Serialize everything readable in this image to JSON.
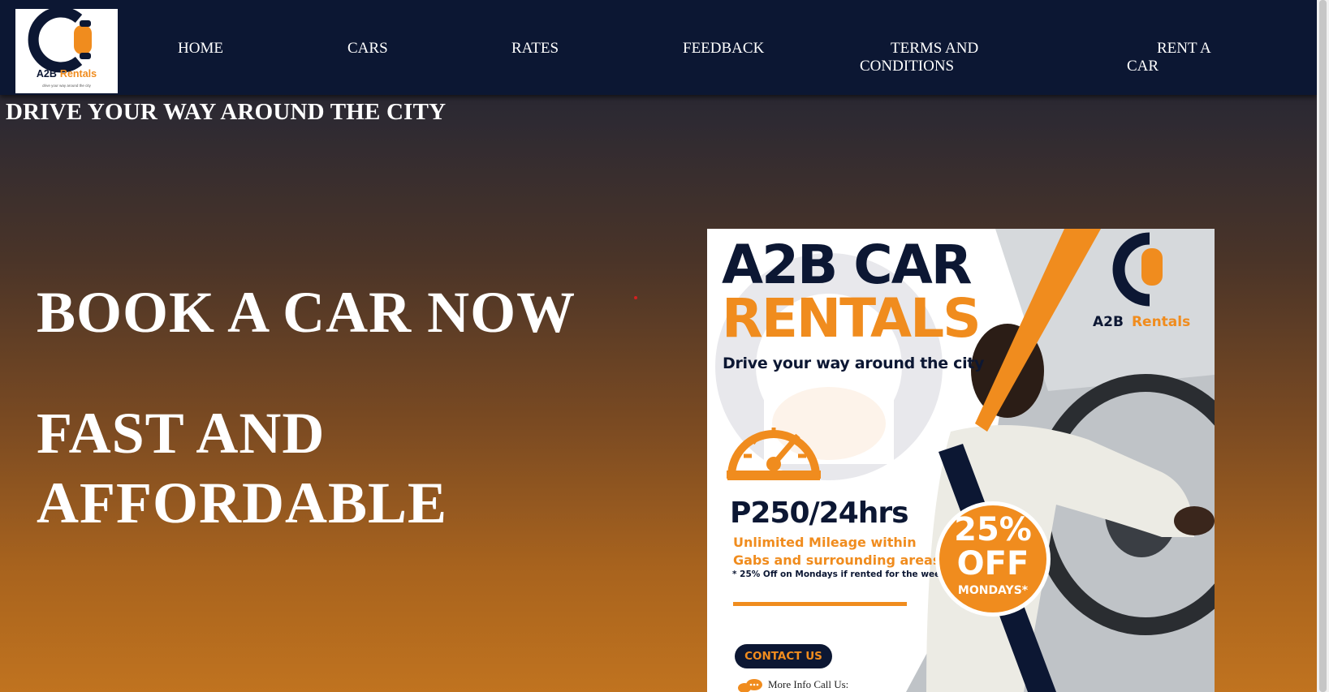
{
  "nav": {
    "logo": {
      "name_a2b": "A2B",
      "name_rentals": "Rentals",
      "tagline": "drive your way around the city"
    },
    "items": [
      {
        "label": "HOME"
      },
      {
        "label": "CARS"
      },
      {
        "label": "RATES"
      },
      {
        "label": "FEEDBACK"
      },
      {
        "label_line1": "TERMS AND",
        "label_line2": "CONDITIONS"
      },
      {
        "label_line1": "RENT A",
        "label_line2": "CAR"
      }
    ]
  },
  "hero": {
    "tagline": "DRIVE YOUR WAY AROUND THE CITY",
    "headline_1": "BOOK A CAR NOW",
    "headline_2_line1": "FAST AND",
    "headline_2_line2": "AFFORDABLE"
  },
  "poster": {
    "title_line1": "A2B CAR",
    "title_line2": "RENTALS",
    "tagline": "Drive your way around the city",
    "logo_a2b": "A2B",
    "logo_rentals": "Rentals",
    "price": "P250/24hrs",
    "mileage_line1": "Unlimited Mileage within",
    "mileage_line2": "Gabs and surrounding areas",
    "footnote": "* 25% Off on Mondays if rented for the weekend",
    "discount_pct": "25%",
    "discount_off": "OFF",
    "discount_day": "MONDAYS*",
    "contact_label": "CONTACT US",
    "more_info": "More Info Call Us:"
  },
  "colors": {
    "navy": "#0c1733",
    "orange": "#f08c1e",
    "white": "#ffffff"
  },
  "icons": [
    "a2b-logo-icon",
    "speedometer-icon",
    "chat-bubble-icon"
  ]
}
